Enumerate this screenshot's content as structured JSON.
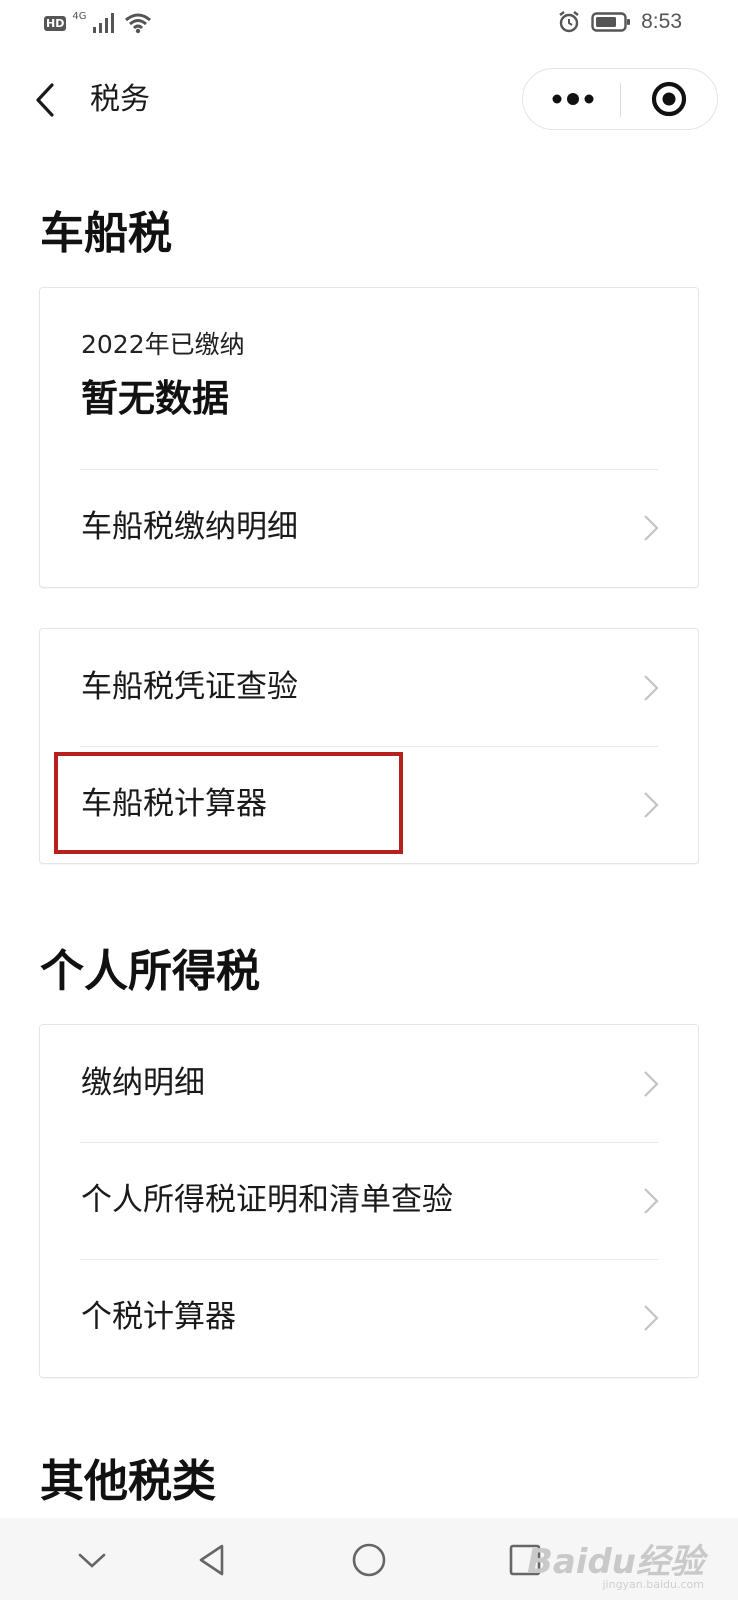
{
  "status_bar": {
    "hd": "HD",
    "network": "4G",
    "time": "8:53"
  },
  "nav": {
    "title": "税务",
    "back_icon": "chevron-left-icon",
    "more_icon": "more-dots-icon",
    "close_icon": "target-close-icon"
  },
  "sections": {
    "vehicle_tax": {
      "heading": "车船税",
      "summary": {
        "year_label": "2022年已缴纳",
        "value": "暂无数据"
      },
      "detail_item": "车船税缴纳明细",
      "items": [
        "车船税凭证查验",
        "车船税计算器"
      ]
    },
    "personal_tax": {
      "heading": "个人所得税",
      "items": [
        "缴纳明细",
        "个人所得税证明和清单查验",
        "个税计算器"
      ]
    },
    "other_tax": {
      "heading": "其他税类"
    }
  },
  "annotation": {
    "highlight_color": "#b8201d",
    "highlighted_item": "车船税计算器"
  },
  "watermark": {
    "brand": "Baidu经验",
    "url": "jingyan.baidu.com"
  },
  "colors": {
    "background": "#ffffff",
    "divider": "#e9e9e9",
    "chevron": "#c4c4c4"
  }
}
